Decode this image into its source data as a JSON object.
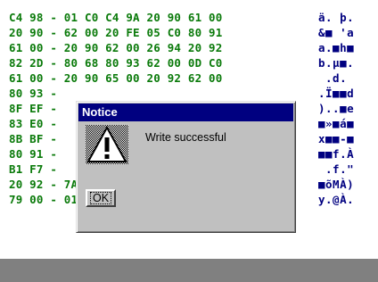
{
  "hex_rows": [
    {
      "hex": "C4 98 - 01 C0 C4 9A 20 90 61 00",
      "ascii": "ä. þ."
    },
    {
      "hex": "20 90 - 62 00 20 FE 05 C0 80 91",
      "ascii": "&■ 'a"
    },
    {
      "hex": "61 00 - 20 90 62 00 26 94 20 92",
      "ascii": "a.■h■"
    },
    {
      "hex": "82 2D - 80 68 80 93 62 00 0D C0",
      "ascii": "b.µ■."
    },
    {
      "hex": "61 00 - 20 90 65 00 20 92 62 00",
      "ascii": " .d. "
    },
    {
      "hex": "80 93 -",
      "ascii": ".Ï■■d"
    },
    {
      "hex": "8F EF -",
      "ascii": ")..■e"
    },
    {
      "hex": "83 E0 -",
      "ascii": "■»■á■"
    },
    {
      "hex": "8B BF -",
      "ascii": "x■■-■"
    },
    {
      "hex": "80 91 -",
      "ascii": "■■f.À"
    },
    {
      "hex": "B1 F7 -",
      "ascii": " .f.\""
    },
    {
      "hex": "20 92 - 7A 00 C0 9A 22 24 20 92",
      "ascii": "■õMÀ)"
    },
    {
      "hex": "79 00 - 01 E0 C9 D0 20 90 7A 00",
      "ascii": "y.@À."
    }
  ],
  "dialog": {
    "title": "Notice",
    "message": "Write successful",
    "ok_label": "OK",
    "icon": "warning-icon"
  },
  "colors": {
    "hex_text": "#0a7a0a",
    "ascii_text": "#000080",
    "title_bar": "#000080",
    "dialog_face": "#c0c0c0",
    "status_bar": "#808080"
  }
}
